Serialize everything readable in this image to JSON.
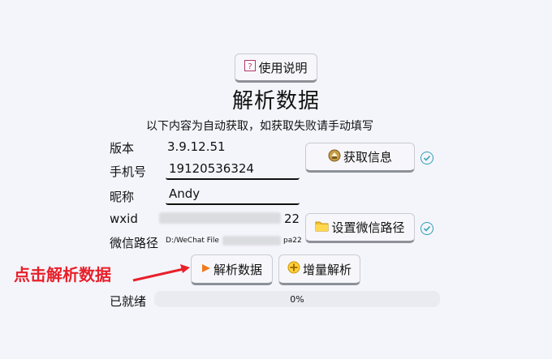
{
  "buttons": {
    "help": "使用说明",
    "get_info": "获取信息",
    "set_path": "设置微信路径",
    "parse": "解析数据",
    "incremental": "增量解析"
  },
  "title": "解析数据",
  "subtitle": "以下内容为自动获取，如获取失败请手动填写",
  "fields": {
    "version_label": "版本",
    "version_value": "3.9.12.51",
    "phone_label": "手机号",
    "phone_value": "19120536324",
    "nickname_label": "昵称",
    "nickname_value": "Andy",
    "wxid_label": "wxid",
    "wxid_suffix": "22",
    "path_label": "微信路径",
    "path_prefix": "D:/WeChat File",
    "path_suffix": "pa22"
  },
  "status": {
    "label": "已就绪",
    "progress_text": "0%",
    "progress": 0
  },
  "annotation": {
    "text": "点击解析数据",
    "color": "#e8202a"
  },
  "colors": {
    "accent": "#2d9fb3",
    "background": "#f4f5fb"
  }
}
